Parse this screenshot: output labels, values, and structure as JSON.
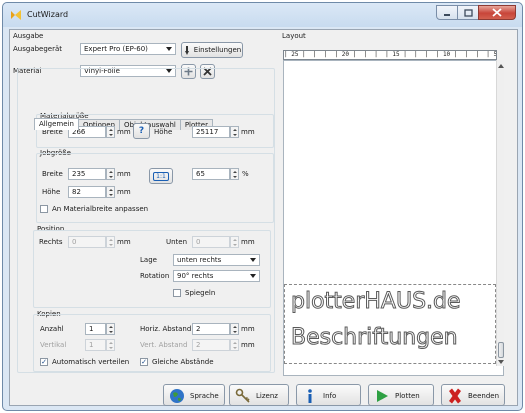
{
  "window": {
    "title": "CutWizard"
  },
  "output_group": {
    "label": "Ausgabe",
    "device_label": "Ausgabegerät",
    "device_value": "Expert Pro (EP-60)",
    "settings_button": "Einstellungen",
    "material_label": "Material",
    "material_value": "Vinyl-Folie"
  },
  "tabs": [
    "Allgemein",
    "Optionen",
    "Objektauswahl",
    "Plotter"
  ],
  "material_size": {
    "label": "Materialgröße",
    "width_label": "Breite",
    "width_value": "266",
    "width_unit": "mm",
    "height_label": "Höhe",
    "height_value": "25117",
    "height_unit": "mm",
    "swap_glyph": "?"
  },
  "job_size": {
    "label": "Jobgröße",
    "width_label": "Breite",
    "width_value": "235",
    "width_unit": "mm",
    "height_label": "Höhe",
    "height_value": "82",
    "height_unit": "mm",
    "ratio_label": "1:1",
    "percent_value": "65",
    "percent_unit": "%",
    "fit_checkbox": "An Materialbreite anpassen"
  },
  "position": {
    "label": "Position",
    "right_label": "Rechts",
    "right_value": "0",
    "right_unit": "mm",
    "bottom_label": "Unten",
    "bottom_value": "0",
    "bottom_unit": "mm",
    "location_label": "Lage",
    "location_value": "unten rechts",
    "rotation_label": "Rotation",
    "rotation_value": "90° rechts",
    "mirror_checkbox": "Spiegeln"
  },
  "copies": {
    "label": "Kopien",
    "count_label": "Anzahl",
    "count_value": "1",
    "hspacing_label": "Horiz. Abstand",
    "hspacing_value": "2",
    "hspacing_unit": "mm",
    "vertical_label": "Vertikal",
    "vertical_value": "1",
    "vspacing_label": "Vert. Abstand",
    "vspacing_value": "2",
    "vspacing_unit": "mm",
    "auto_distribute_checkbox": "Automatisch verteilen",
    "equal_spacing_checkbox": "Gleiche Abstände",
    "check_glyph": "✓"
  },
  "layout": {
    "label": "Layout",
    "ruler_text": "| 25 |  |  |  | 20 |  |  |  | 15 |  |  |  | 10 |  |  |  | 5 |  |  |  |",
    "preview_line1": "plotterHAUS.de",
    "preview_line2": "Beschriftungen"
  },
  "buttons": {
    "language": "Sprache",
    "license": "Lizenz",
    "info": "Info",
    "plot": "Plotten",
    "exit": "Beenden"
  },
  "colors": {
    "title_bar": "#c8dbef",
    "close_red": "#c8453a",
    "info_blue": "#1a5fb4",
    "plot_green": "#2ea043",
    "exit_red": "#cc2020"
  }
}
